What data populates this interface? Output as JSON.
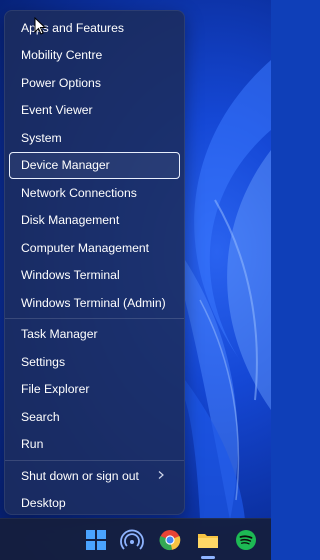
{
  "menu": {
    "groups": [
      [
        {
          "label": "Apps and Features"
        },
        {
          "label": "Mobility Centre"
        },
        {
          "label": "Power Options"
        },
        {
          "label": "Event Viewer"
        },
        {
          "label": "System"
        },
        {
          "label": "Device Manager",
          "focused": true
        },
        {
          "label": "Network Connections"
        },
        {
          "label": "Disk Management"
        },
        {
          "label": "Computer Management"
        },
        {
          "label": "Windows Terminal"
        },
        {
          "label": "Windows Terminal (Admin)"
        }
      ],
      [
        {
          "label": "Task Manager"
        },
        {
          "label": "Settings"
        },
        {
          "label": "File Explorer"
        },
        {
          "label": "Search"
        },
        {
          "label": "Run"
        }
      ],
      [
        {
          "label": "Shut down or sign out",
          "submenu": true
        },
        {
          "label": "Desktop"
        }
      ]
    ]
  },
  "taskbar": {
    "icons": [
      {
        "name": "start-icon",
        "color": "#4aa3ff"
      },
      {
        "name": "wireless-display-icon",
        "color": "#8fb4ff"
      },
      {
        "name": "chrome-icon",
        "color": "#e84335"
      },
      {
        "name": "file-explorer-icon",
        "color": "#f6c343"
      },
      {
        "name": "spotify-icon",
        "color": "#1db954"
      }
    ]
  },
  "colors": {
    "menu_background": "#1c2c5c",
    "wallpaper_blue": "#1548d6",
    "focus_outline": "#e8eefc"
  }
}
